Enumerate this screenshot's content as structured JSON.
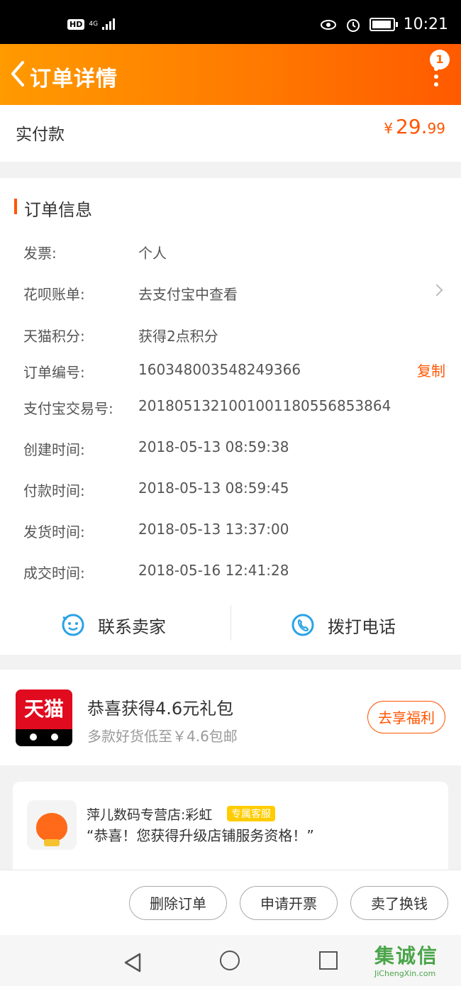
{
  "status_bar": {
    "hd": "HD",
    "network": "4G",
    "time": "10:21"
  },
  "header": {
    "title": "订单详情",
    "notification_count": "1"
  },
  "paid": {
    "label": "实付款",
    "currency": "¥",
    "amount_int": "29.",
    "amount_dec": "99"
  },
  "order_info": {
    "title": "订单信息",
    "rows": [
      {
        "label": "发票:",
        "value": "个人"
      },
      {
        "label": "花呗账单:",
        "value": "去支付宝中查看"
      },
      {
        "label": "天猫积分:",
        "value": "获得2点积分"
      },
      {
        "label": "订单编号:",
        "value": "160348003548249366"
      },
      {
        "label": "支付宝交易号:",
        "value": "2018051321001001180556853864"
      },
      {
        "label": "创建时间:",
        "value": "2018-05-13 08:59:38"
      },
      {
        "label": "付款时间:",
        "value": "2018-05-13 08:59:45"
      },
      {
        "label": "发货时间:",
        "value": "2018-05-13 13:37:00"
      },
      {
        "label": "成交时间:",
        "value": "2018-05-16 12:41:28"
      }
    ],
    "copy_label": "复制",
    "contact_seller": "联系卖家",
    "call_phone": "拨打电话"
  },
  "promo": {
    "logo_text": "天猫",
    "title": "恭喜获得4.6元礼包",
    "subtitle": "多款好货低至￥4.6包邮",
    "button": "去享福利"
  },
  "shop": {
    "name": "萍儿数码专营店:彩虹",
    "badge": "专属客服",
    "message": "“恭喜！您获得升级店铺服务资格！”"
  },
  "bottom_actions": {
    "delete": "删除订单",
    "invoice": "申请开票",
    "sell": "卖了换钱"
  },
  "watermark": {
    "logo": "集诚信",
    "url": "JiChengXin.com"
  },
  "colors": {
    "accent": "#ff5500",
    "header_start": "#ff9a00",
    "header_end": "#ff5a00",
    "icon_blue": "#2aa3e6"
  }
}
